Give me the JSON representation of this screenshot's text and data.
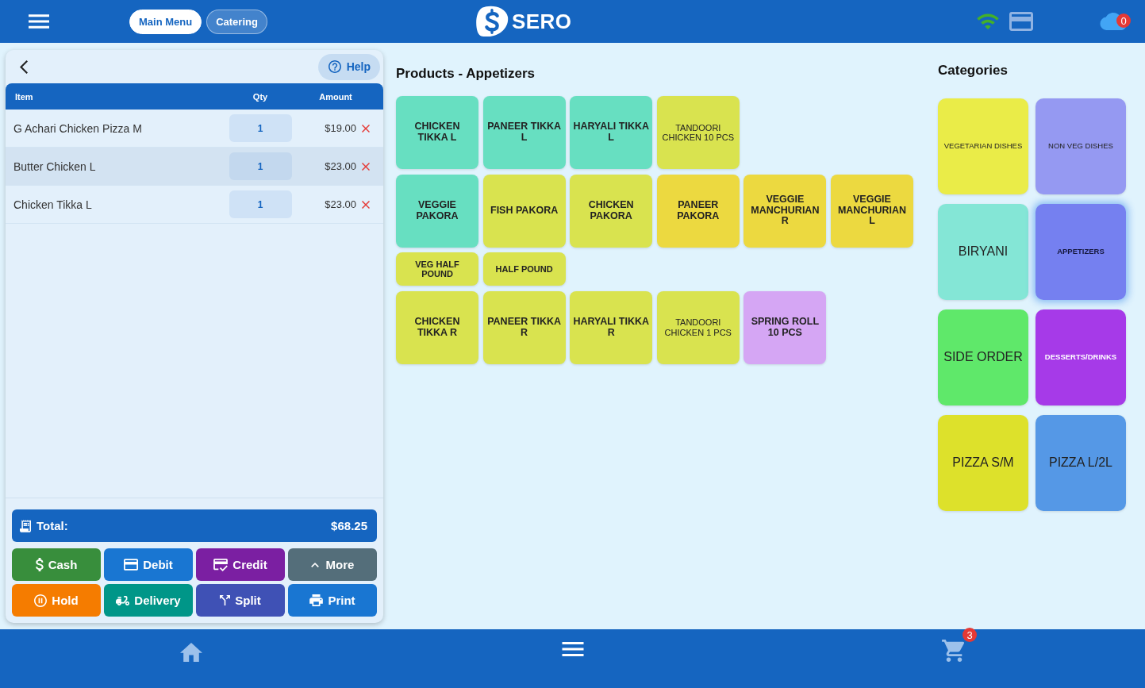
{
  "header": {
    "tabs": [
      {
        "label": "Main Menu",
        "selected": true
      },
      {
        "label": "Catering",
        "selected": false
      }
    ],
    "logo": "SERO",
    "cloud_badge": "0"
  },
  "order": {
    "help": "Help",
    "columns": [
      "Item",
      "Qty",
      "Amount"
    ],
    "rows": [
      {
        "item": "G Achari Chicken Pizza M",
        "qty": "1",
        "amount": "$19.00",
        "selected": false
      },
      {
        "item": "Butter Chicken L",
        "qty": "1",
        "amount": "$23.00",
        "selected": true
      },
      {
        "item": "Chicken Tikka L",
        "qty": "1",
        "amount": "$23.00",
        "selected": false
      }
    ],
    "total_label": "Total:",
    "total": "$68.25",
    "actions": [
      {
        "label": "Cash",
        "kind": "cash",
        "color": "#388e3c"
      },
      {
        "label": "Debit",
        "kind": "debit",
        "color": "#1976d2"
      },
      {
        "label": "Credit",
        "kind": "credit",
        "color": "#7b1fa2"
      },
      {
        "label": "More",
        "kind": "more",
        "color": "#546e7a"
      },
      {
        "label": "Hold",
        "kind": "hold",
        "color": "#f57c00"
      },
      {
        "label": "Delivery",
        "kind": "delivery",
        "color": "#009688"
      },
      {
        "label": "Split",
        "kind": "split",
        "color": "#3f51b5"
      },
      {
        "label": "Print",
        "kind": "print",
        "color": "#1976d2"
      }
    ]
  },
  "products": {
    "title": "Products - Appetizers",
    "rows": [
      {
        "items": [
          {
            "label": "CHICKEN TIKKA L",
            "kind": "regular",
            "color": "#67dfc1"
          },
          {
            "label": "PANEER TIKKA L",
            "kind": "regular",
            "color": "#67dfc1"
          },
          {
            "label": "HARYALI TIKKA L",
            "kind": "regular",
            "color": "#67dfc1"
          },
          {
            "label": "TANDOORI CHICKEN 10 PCS",
            "kind": "small",
            "color": "#d9e34f"
          }
        ]
      },
      {
        "items": [
          {
            "label": "VEGGIE PAKORA",
            "kind": "regular",
            "color": "#67dfc1"
          },
          {
            "label": "FISH PAKORA",
            "kind": "regular",
            "color": "#d9e34f"
          },
          {
            "label": "CHICKEN PAKORA",
            "kind": "regular",
            "color": "#d9e34f"
          },
          {
            "label": "PANEER PAKORA",
            "kind": "regular",
            "color": "#ecd940"
          },
          {
            "label": "VEGGIE MANCHURIAN R",
            "kind": "regular",
            "color": "#ecd940"
          },
          {
            "label": "VEGGIE MANCHURIAN L",
            "kind": "regular",
            "color": "#ecd940"
          }
        ]
      },
      {
        "items": [
          {
            "label": "VEG HALF POUND",
            "kind": "compact",
            "color": "#d9e34f"
          },
          {
            "label": "HALF POUND",
            "kind": "compact",
            "color": "#d9e34f"
          }
        ]
      },
      {
        "items": [
          {
            "label": "CHICKEN TIKKA R",
            "kind": "regular",
            "color": "#d9e34f"
          },
          {
            "label": "PANEER TIKKA R",
            "kind": "regular",
            "color": "#d9e34f"
          },
          {
            "label": "HARYALI TIKKA R",
            "kind": "regular",
            "color": "#d9e34f"
          },
          {
            "label": "TANDOORI CHICKEN 1 PCS",
            "kind": "small",
            "color": "#d9e34f"
          },
          {
            "label": "SPRING ROLL 10 PCS",
            "kind": "regular",
            "color": "#d5a6f4"
          }
        ]
      }
    ]
  },
  "categories": {
    "title": "Categories",
    "items": [
      {
        "label": "VEGETARIAN DISHES",
        "kind": "small",
        "color": "#eaec48",
        "selected": false
      },
      {
        "label": "NON VEG DISHES",
        "kind": "small",
        "color": "#9599f2",
        "selected": false
      },
      {
        "label": "BIRYANI",
        "kind": "large",
        "color": "#84e6d6",
        "selected": false
      },
      {
        "label": "APPETIZERS",
        "kind": "bold",
        "color": "#7580f0",
        "selected": true
      },
      {
        "label": "SIDE ORDER",
        "kind": "large",
        "color": "#5fe86a",
        "selected": false
      },
      {
        "label": "DESSERTS/DRINKS",
        "kind": "bold",
        "color": "#a63ae8",
        "selected": false
      },
      {
        "label": "PIZZA S/M",
        "kind": "large",
        "color": "#dde12b",
        "selected": false
      },
      {
        "label": "PIZZA L/2L",
        "kind": "large",
        "color": "#5598e6",
        "selected": false
      }
    ]
  },
  "footer": {
    "cart_badge": "3"
  }
}
